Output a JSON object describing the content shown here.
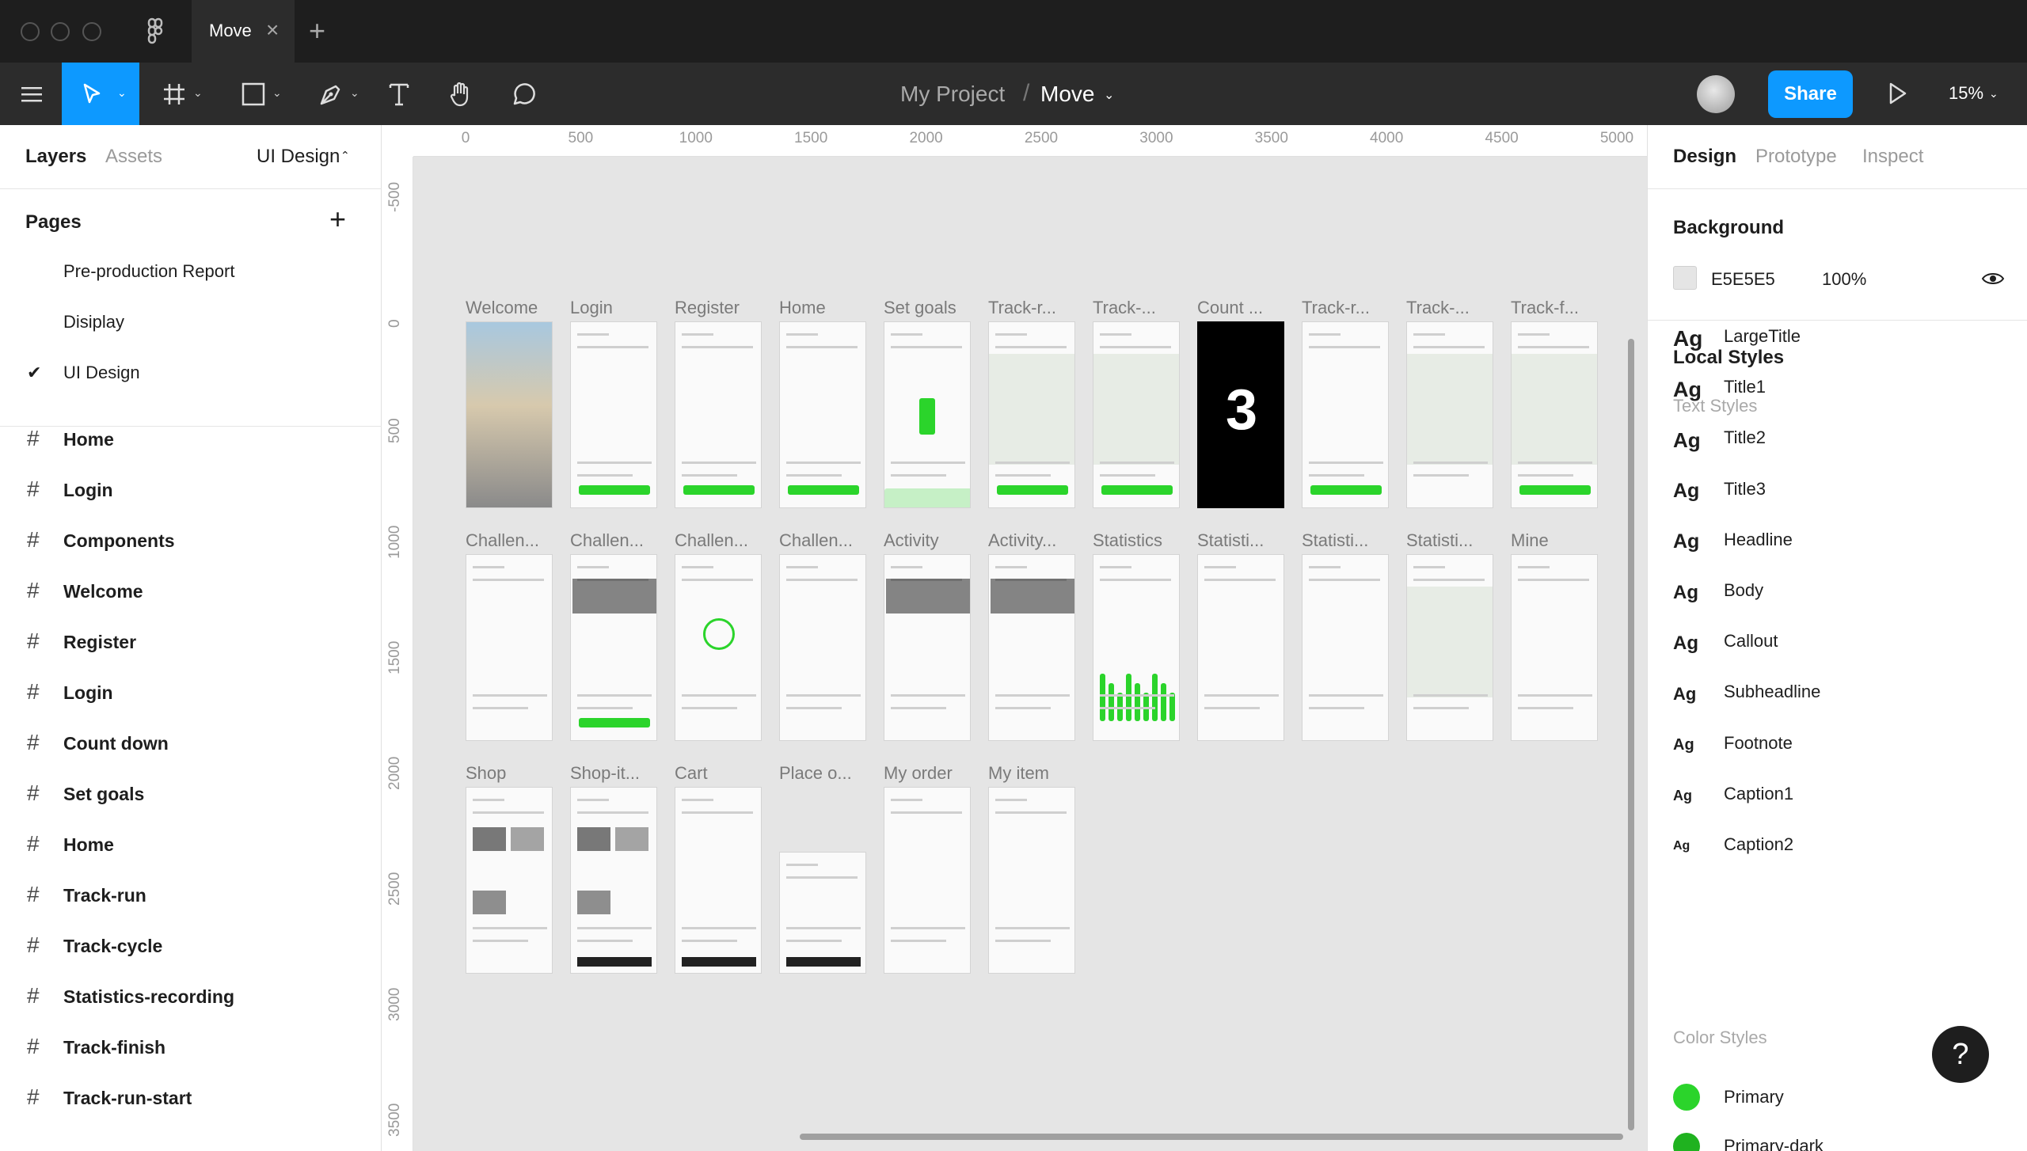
{
  "window": {
    "tab_title": "Move",
    "tab_close": "×",
    "new_tab": "+"
  },
  "toolbar": {
    "project": "My Project",
    "separator": "/",
    "file": "Move",
    "share": "Share",
    "zoom": "15%"
  },
  "left_panel": {
    "tabs": [
      "Layers",
      "Assets"
    ],
    "page_selector": "UI Design",
    "pages_title": "Pages",
    "add_page": "+",
    "pages": [
      {
        "label": "Pre-production Report",
        "selected": false
      },
      {
        "label": "Disiplay",
        "selected": false
      },
      {
        "label": "UI Design",
        "selected": true
      }
    ],
    "layers": [
      "Home",
      "Login",
      "Components",
      "Welcome",
      "Register",
      "Login",
      "Count down",
      "Set goals",
      "Home",
      "Track-run",
      "Track-cycle",
      "Statistics-recording",
      "Track-finish",
      "Track-run-start"
    ]
  },
  "canvas": {
    "background": "#E5E5E5",
    "ruler_top": [
      "0",
      "500",
      "1000",
      "1500",
      "2000",
      "2500",
      "3000",
      "3500",
      "4000",
      "4500",
      "5000"
    ],
    "ruler_left": [
      "-500",
      "0",
      "500",
      "1000",
      "1500",
      "2000",
      "2500",
      "3000",
      "3500"
    ],
    "frames_row1": [
      "Welcome",
      "Login",
      "Register",
      "Home",
      "Set goals",
      "Track-r...",
      "Track-...",
      "Count ...",
      "Track-r...",
      "Track-...",
      "Track-f..."
    ],
    "frames_row2": [
      "Challen...",
      "Challen...",
      "Challen...",
      "Challen...",
      "Activity",
      "Activity...",
      "Statistics",
      "Statisti...",
      "Statisti...",
      "Statisti...",
      "Mine"
    ],
    "frames_row3": [
      "Shop",
      "Shop-it...",
      "Cart",
      "Place o...",
      "My order",
      "My item"
    ],
    "count_digit": "3"
  },
  "right_panel": {
    "tabs": [
      "Design",
      "Prototype",
      "Inspect"
    ],
    "background_title": "Background",
    "background_hex": "E5E5E5",
    "background_opacity": "100%",
    "local_styles": "Local Styles",
    "text_styles_title": "Text Styles",
    "text_styles": [
      "LargeTitle",
      "Title1",
      "Title2",
      "Title3",
      "Headline",
      "Body",
      "Callout",
      "Subheadline",
      "Footnote",
      "Caption1",
      "Caption2"
    ],
    "ag": "Ag",
    "color_styles_title": "Color Styles",
    "color_styles": [
      {
        "name": "Primary",
        "color": "#2BD42B"
      },
      {
        "name": "Primary-dark",
        "color": "#1FB21F"
      }
    ],
    "help": "?"
  },
  "colors": {
    "accent": "#0D99FF",
    "toolbar_bg": "#2C2C2C",
    "titlebar_bg": "#1E1E1E"
  }
}
